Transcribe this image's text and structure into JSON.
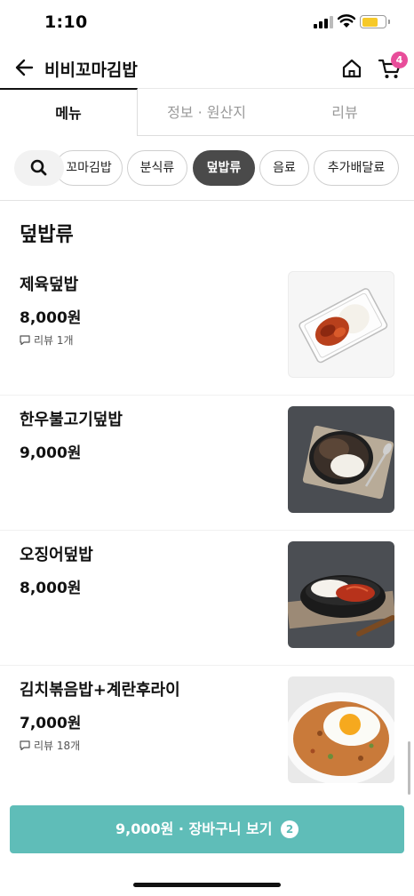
{
  "status_bar": {
    "time": "1:10"
  },
  "header": {
    "title": "비비꼬마김밥",
    "cart_count": "4"
  },
  "tabs": [
    {
      "label": "메뉴"
    },
    {
      "label": "정보 · 원산지"
    },
    {
      "label": "리뷰"
    }
  ],
  "categories": [
    {
      "label": "꼬마김밥"
    },
    {
      "label": "분식류"
    },
    {
      "label": "덮밥류"
    },
    {
      "label": "음료"
    },
    {
      "label": "추가배달료"
    }
  ],
  "section": {
    "title": "덮밥류"
  },
  "items": [
    {
      "name": "제육덮밥",
      "price": "8,000원",
      "review": "리뷰 1개"
    },
    {
      "name": "한우불고기덮밥",
      "price": "9,000원",
      "review": ""
    },
    {
      "name": "오징어덮밥",
      "price": "8,000원",
      "review": ""
    },
    {
      "name": "김치볶음밥+계란후라이",
      "price": "7,000원",
      "review": "리뷰 18개"
    }
  ],
  "cart_bar": {
    "label": "9,000원 · 장바구니 보기",
    "count": "2"
  },
  "colors": {
    "accent": "#5fbdb8",
    "badge": "#e84d9a",
    "active_chip": "#4a4a4a"
  }
}
